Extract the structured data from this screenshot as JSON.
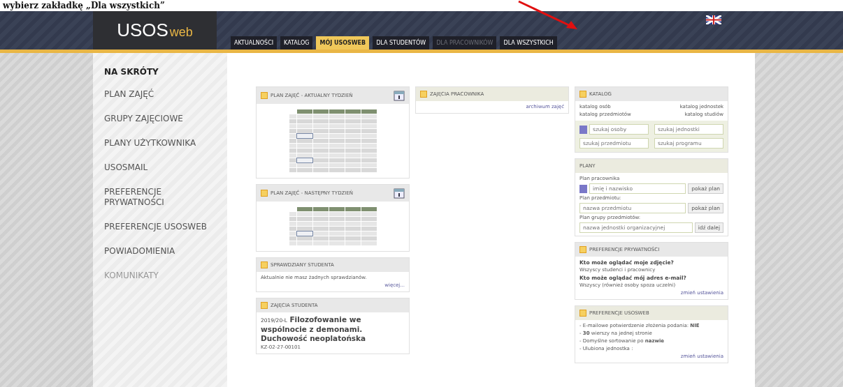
{
  "annotation": {
    "caption": "wybierz zakładkę „Dla wszystkich”"
  },
  "header": {
    "logo_main": "USOS",
    "logo_sub": "web",
    "tabs": [
      {
        "label": "AKTUALNOŚCI",
        "selected": false,
        "disabled": false
      },
      {
        "label": "KATALOG",
        "selected": false,
        "disabled": false
      },
      {
        "label": "MÓJ USOSWEB",
        "selected": true,
        "disabled": false
      },
      {
        "label": "DLA STUDENTÓW",
        "selected": false,
        "disabled": false
      },
      {
        "label": "DLA PRACOWNIKÓW",
        "selected": false,
        "disabled": true
      },
      {
        "label": "DLA WSZYSTKICH",
        "selected": false,
        "disabled": false
      }
    ]
  },
  "sidebar": {
    "title": "NA SKRÓTY",
    "items": [
      {
        "label": "PLAN ZAJĘĆ",
        "disabled": false
      },
      {
        "label": "GRUPY ZAJĘCIOWE",
        "disabled": false
      },
      {
        "label": "PLANY UŻYTKOWNIKA",
        "disabled": false
      },
      {
        "label": "USOSMAIL",
        "disabled": false
      },
      {
        "label": "PREFERENCJE PRYWATNOŚCI",
        "disabled": false
      },
      {
        "label": "PREFERENCJE USOSWEB",
        "disabled": false
      },
      {
        "label": "POWIADOMIENIA",
        "disabled": false
      },
      {
        "label": "KOMUNIKATY",
        "disabled": true
      }
    ]
  },
  "columns": [
    [
      {
        "kind": "timetable",
        "title": "PLAN ZAJĘĆ - AKTUALNY TYDZIEŃ"
      },
      {
        "kind": "timetable",
        "title": "PLAN ZAJĘĆ - NASTĘPNY TYDZIEŃ"
      },
      {
        "kind": "text",
        "title": "SPRAWDZIANY STUDENTA",
        "text": "Aktualnie nie masz żadnych sprawdzianów.",
        "link": "więcej..."
      },
      {
        "kind": "course",
        "title": "ZAJĘCIA STUDENTA",
        "term": "2019/20-L",
        "name": "Filozofowanie we wspólnocie z demonami. Duchowość neoplatońska",
        "code": "KZ-02-27-00101"
      }
    ],
    [
      {
        "kind": "link",
        "title": "ZAJĘCIA PRACOWNIKA",
        "link": "archiwum zajęć"
      }
    ],
    [
      {
        "kind": "catalog",
        "title": "KATALOG",
        "links": [
          "katalog osób",
          "katalog jednostek",
          "katalog przedmiotów",
          "katalog studiów"
        ],
        "placeholders": [
          "szukaj osoby",
          "szukaj jednostki",
          "szukaj przedmiotu",
          "szukaj programu"
        ]
      },
      {
        "kind": "plans",
        "title": "PLANY",
        "rows": [
          {
            "label": "Plan pracownika",
            "placeholder": "imię i nazwisko",
            "button": "pokaż plan"
          },
          {
            "label": "Plan przedmiotu:",
            "placeholder": "nazwa przedmiotu",
            "button": "pokaż plan"
          },
          {
            "label": "Plan grupy przedmiotów:",
            "placeholder": "nazwa jednostki organizacyjnej",
            "button": "idź dalej"
          }
        ]
      },
      {
        "kind": "qa",
        "title": "PREFERENCJE PRYWATNOŚCI",
        "items": [
          {
            "q": "Kto może oglądać moje zdjęcie?",
            "a": "Wszyscy studenci i pracownicy"
          },
          {
            "q": "Kto może oglądać mój adres e-mail?",
            "a": "Wszyscy (również osoby spoza uczelni)"
          }
        ],
        "link": "zmień ustawienia"
      },
      {
        "kind": "list",
        "title": "PREFERENCJE USOSWEB",
        "items": [
          "- E-mailowe potwierdzenie złożenia podania: **NIE**",
          "- **30** wierszy na jednej stronie",
          "- Domyślne sortowanie po **nazwie**",
          "- Ulubiona jednostka :"
        ],
        "link": "zmień ustawienia"
      }
    ]
  ]
}
